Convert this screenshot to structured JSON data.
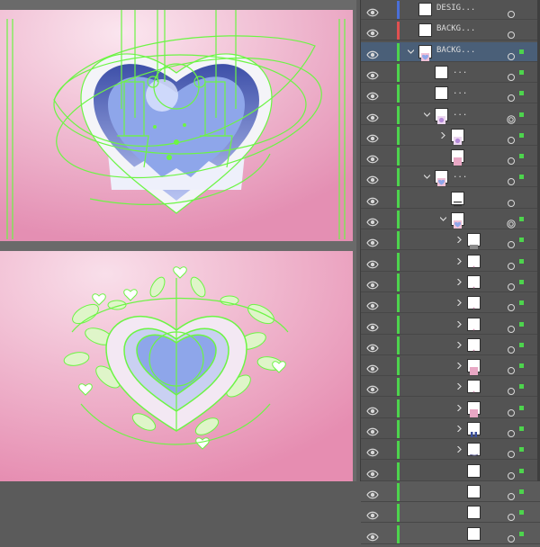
{
  "colors": {
    "selection_green": "#6cf544",
    "layer_green": "#4dd44d",
    "pink_bg": "#e6a3c0",
    "heart_blue": "#8ea6ea",
    "panel_bg": "#535353",
    "selected_row": "#4a5f78"
  },
  "layers": [
    {
      "name": "DESIG...",
      "indent": 0,
      "arrow": "",
      "thumb": "white",
      "bar": "#4a6fd8",
      "target": "ring",
      "square": false,
      "selected": false
    },
    {
      "name": "BACKG...",
      "indent": 0,
      "arrow": "",
      "thumb": "white",
      "bar": "#e05050",
      "target": "ring",
      "square": false,
      "selected": false
    },
    {
      "name": "BACKG...",
      "indent": 0,
      "arrow": "down",
      "thumb": "pinkheart",
      "bar": "#4dd44d",
      "target": "ring",
      "square": true,
      "selected": true
    },
    {
      "name": "...",
      "indent": 1,
      "arrow": "",
      "thumb": "white",
      "bar": "#4dd44d",
      "target": "ring",
      "square": true,
      "selected": false
    },
    {
      "name": "...",
      "indent": 1,
      "arrow": "",
      "thumb": "white",
      "bar": "#4dd44d",
      "target": "ring",
      "square": true,
      "selected": false
    },
    {
      "name": "...",
      "indent": 1,
      "arrow": "down",
      "thumb": "flower",
      "bar": "#4dd44d",
      "target": "double",
      "square": true,
      "selected": false
    },
    {
      "name": "",
      "indent": 2,
      "arrow": "right",
      "thumb": "flower",
      "bar": "#4dd44d",
      "target": "ring",
      "square": true,
      "selected": false
    },
    {
      "name": "",
      "indent": 2,
      "arrow": "",
      "thumb": "pink",
      "bar": "#4dd44d",
      "target": "ring",
      "square": true,
      "selected": false
    },
    {
      "name": "...",
      "indent": 1,
      "arrow": "down",
      "thumb": "pinkheart",
      "bar": "#4dd44d",
      "target": "ring",
      "square": true,
      "selected": false
    },
    {
      "name": "",
      "indent": 2,
      "arrow": "",
      "thumb": "lines",
      "bar": "#4dd44d",
      "target": "ring",
      "square": false,
      "selected": false
    },
    {
      "name": "",
      "indent": 2,
      "arrow": "down",
      "thumb": "pinkheart",
      "bar": "#4dd44d",
      "target": "double",
      "square": true,
      "selected": false
    },
    {
      "name": "",
      "indent": 3,
      "arrow": "right",
      "thumb": "gray",
      "bar": "#4dd44d",
      "target": "ring",
      "square": true,
      "selected": false
    },
    {
      "name": "",
      "indent": 3,
      "arrow": "right",
      "thumb": "dots",
      "bar": "#4dd44d",
      "target": "ring",
      "square": true,
      "selected": false
    },
    {
      "name": "",
      "indent": 3,
      "arrow": "right",
      "thumb": "dots",
      "bar": "#4dd44d",
      "target": "ring",
      "square": true,
      "selected": false
    },
    {
      "name": "",
      "indent": 3,
      "arrow": "right",
      "thumb": "dots",
      "bar": "#4dd44d",
      "target": "ring",
      "square": true,
      "selected": false
    },
    {
      "name": "",
      "indent": 3,
      "arrow": "right",
      "thumb": "dots",
      "bar": "#4dd44d",
      "target": "ring",
      "square": true,
      "selected": false
    },
    {
      "name": "",
      "indent": 3,
      "arrow": "right",
      "thumb": "dots",
      "bar": "#4dd44d",
      "target": "ring",
      "square": true,
      "selected": false
    },
    {
      "name": "",
      "indent": 3,
      "arrow": "right",
      "thumb": "pink",
      "bar": "#4dd44d",
      "target": "ring",
      "square": true,
      "selected": false
    },
    {
      "name": "",
      "indent": 3,
      "arrow": "right",
      "thumb": "dots",
      "bar": "#4dd44d",
      "target": "ring",
      "square": true,
      "selected": false
    },
    {
      "name": "",
      "indent": 3,
      "arrow": "right",
      "thumb": "pink",
      "bar": "#4dd44d",
      "target": "ring",
      "square": true,
      "selected": false
    },
    {
      "name": "",
      "indent": 3,
      "arrow": "right",
      "thumb": "figures",
      "bar": "#4dd44d",
      "target": "ring",
      "square": true,
      "selected": false
    },
    {
      "name": "",
      "indent": 3,
      "arrow": "right",
      "thumb": "wave",
      "bar": "#4dd44d",
      "target": "ring",
      "square": true,
      "selected": false
    },
    {
      "name": "",
      "indent": 3,
      "arrow": "",
      "thumb": "white",
      "bar": "#4dd44d",
      "target": "ring",
      "square": true,
      "selected": false
    },
    {
      "name": "",
      "indent": 3,
      "arrow": "",
      "thumb": "white",
      "bar": "#4dd44d",
      "target": "ring",
      "square": true,
      "selected": false
    },
    {
      "name": "",
      "indent": 3,
      "arrow": "",
      "thumb": "white",
      "bar": "#4dd44d",
      "target": "ring",
      "square": true,
      "selected": false
    },
    {
      "name": "",
      "indent": 3,
      "arrow": "",
      "thumb": "white",
      "bar": "#4dd44d",
      "target": "ring",
      "square": true,
      "selected": false
    }
  ]
}
